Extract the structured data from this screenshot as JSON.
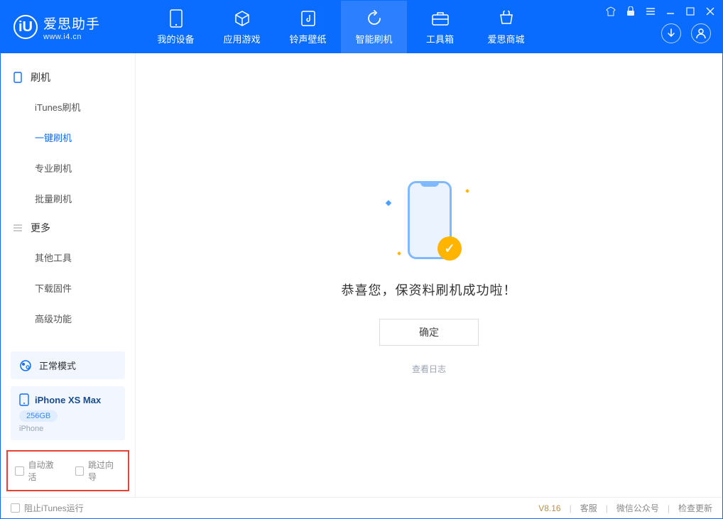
{
  "app": {
    "logo_letter": "iU",
    "name": "爱思助手",
    "site": "www.i4.cn"
  },
  "nav": {
    "items": [
      {
        "label": "我的设备",
        "icon": "device-icon"
      },
      {
        "label": "应用游戏",
        "icon": "cube-icon"
      },
      {
        "label": "铃声壁纸",
        "icon": "music-icon"
      },
      {
        "label": "智能刷机",
        "icon": "refresh-icon",
        "active": true
      },
      {
        "label": "工具箱",
        "icon": "toolbox-icon"
      },
      {
        "label": "爱思商城",
        "icon": "shop-icon"
      }
    ]
  },
  "sidebar": {
    "group1": {
      "title": "刷机",
      "items": [
        {
          "label": "iTunes刷机"
        },
        {
          "label": "一键刷机",
          "active": true
        },
        {
          "label": "专业刷机"
        },
        {
          "label": "批量刷机"
        }
      ]
    },
    "group2": {
      "title": "更多",
      "items": [
        {
          "label": "其他工具"
        },
        {
          "label": "下载固件"
        },
        {
          "label": "高级功能"
        }
      ]
    },
    "mode": {
      "label": "正常模式"
    },
    "device": {
      "name": "iPhone XS Max",
      "storage": "256GB",
      "type": "iPhone"
    },
    "options": {
      "auto_activate": "自动激活",
      "skip_guide": "跳过向导"
    }
  },
  "main": {
    "success_msg": "恭喜您，保资料刷机成功啦！",
    "ok_button": "确定",
    "view_log": "查看日志"
  },
  "footer": {
    "block_itunes": "阻止iTunes运行",
    "version": "V8.16",
    "links": {
      "service": "客服",
      "wechat": "微信公众号",
      "update": "检查更新"
    }
  }
}
